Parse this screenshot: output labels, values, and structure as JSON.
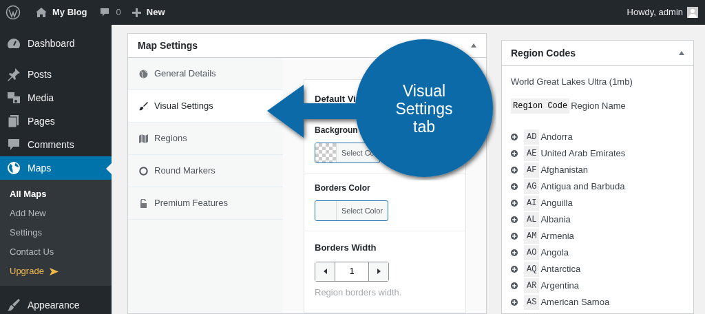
{
  "admin_bar": {
    "site": "My Blog",
    "comments": "0",
    "new": "New",
    "greeting": "Howdy, admin"
  },
  "sidebar": {
    "items": [
      {
        "label": "Dashboard",
        "selected": false
      },
      {
        "label": "Posts",
        "selected": false
      },
      {
        "label": "Media",
        "selected": false
      },
      {
        "label": "Pages",
        "selected": false
      },
      {
        "label": "Comments",
        "selected": false
      },
      {
        "label": "Maps",
        "selected": true,
        "children": [
          {
            "label": "All Maps",
            "selected": true,
            "kind": "link"
          },
          {
            "label": "Add New",
            "selected": false,
            "kind": "link"
          },
          {
            "label": "Settings",
            "selected": false,
            "kind": "link"
          },
          {
            "label": "Contact Us",
            "selected": false,
            "kind": "link"
          },
          {
            "label": "Upgrade",
            "selected": false,
            "kind": "upgrade"
          }
        ]
      },
      {
        "label": "Appearance",
        "selected": false
      }
    ]
  },
  "map_settings": {
    "title": "Map Settings",
    "tabs": [
      {
        "label": "General Details",
        "selected": false
      },
      {
        "label": "Visual Settings",
        "selected": true
      },
      {
        "label": "Regions",
        "selected": false
      },
      {
        "label": "Round Markers",
        "selected": false
      },
      {
        "label": "Premium Features",
        "selected": false
      }
    ],
    "section_title": "Default Vi",
    "fields": [
      {
        "label": "Backgroun",
        "button": "Select Co",
        "transparent": true
      },
      {
        "label": "Borders Color",
        "button": "Select Color",
        "transparent": false
      }
    ],
    "borders_width": {
      "label": "Borders Width",
      "value": "1",
      "description": "Region borders width."
    }
  },
  "region_codes": {
    "title": "Region Codes",
    "map_name": "World Great Lakes Ultra (1mb)",
    "header_code": "Region Code",
    "header_name": "Region Name",
    "regions": [
      {
        "code": "AD",
        "name": "Andorra"
      },
      {
        "code": "AE",
        "name": "United Arab Emirates"
      },
      {
        "code": "AF",
        "name": "Afghanistan"
      },
      {
        "code": "AG",
        "name": "Antigua and Barbuda"
      },
      {
        "code": "AI",
        "name": "Anguilla"
      },
      {
        "code": "AL",
        "name": "Albania"
      },
      {
        "code": "AM",
        "name": "Armenia"
      },
      {
        "code": "AO",
        "name": "Angola"
      },
      {
        "code": "AQ",
        "name": "Antarctica"
      },
      {
        "code": "AR",
        "name": "Argentina"
      },
      {
        "code": "AS",
        "name": "American Samoa"
      }
    ]
  },
  "callout": {
    "text": "Visual Settings tab"
  }
}
